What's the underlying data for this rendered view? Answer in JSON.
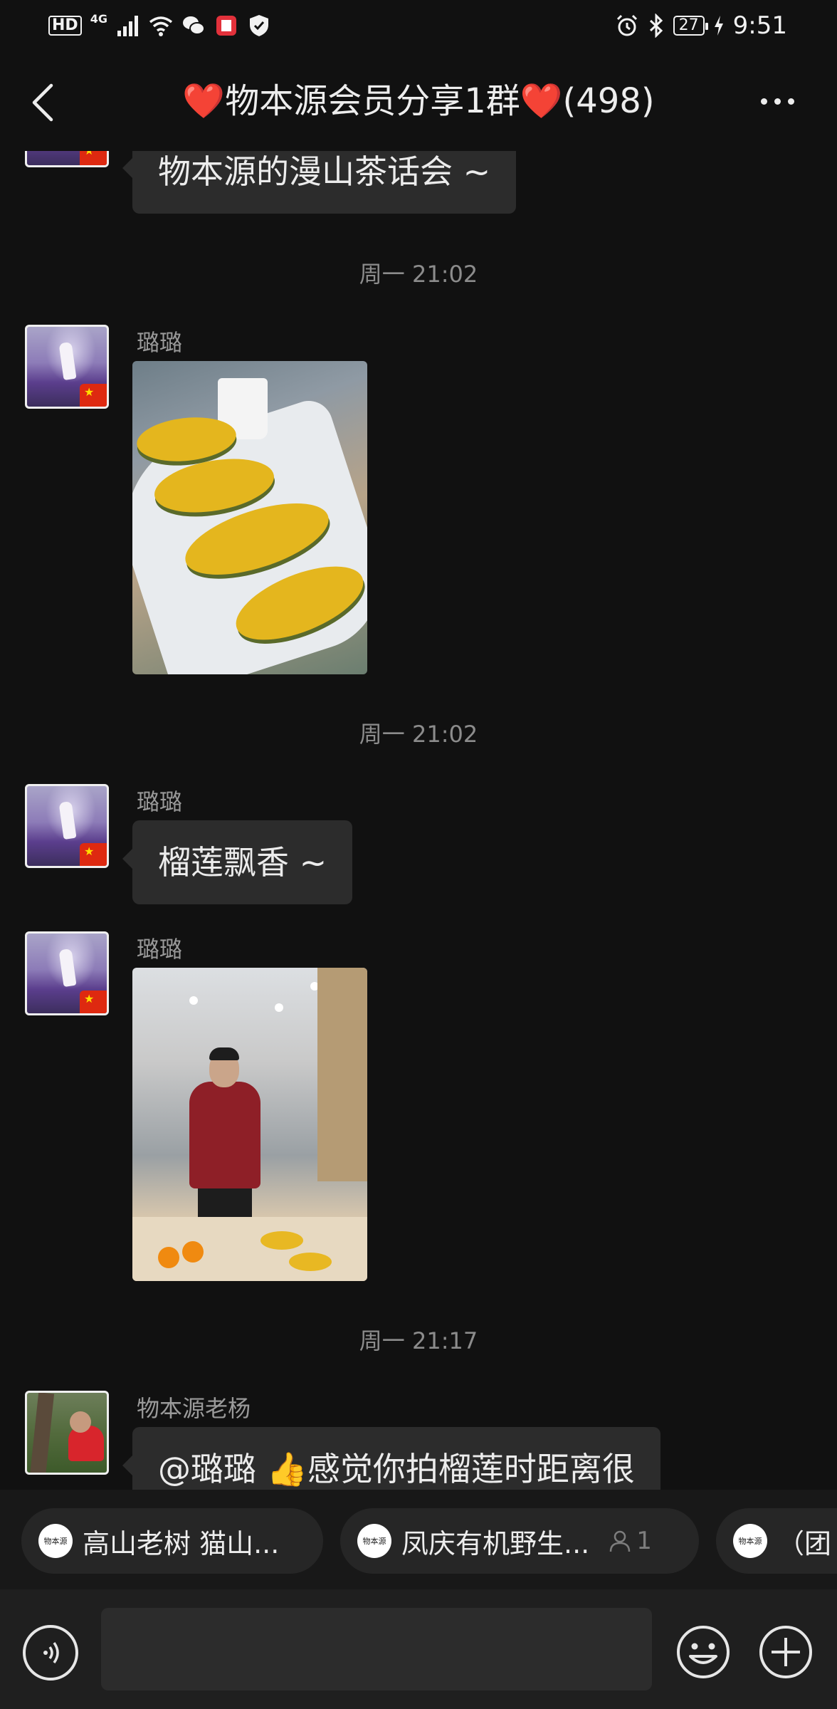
{
  "status_bar": {
    "hd": "HD",
    "network": "4G",
    "battery": "27",
    "time": "9:51"
  },
  "header": {
    "heart_left": "❤️",
    "title": "物本源会员分享1群",
    "heart_right": "❤️",
    "member_count": "(498)"
  },
  "messages": {
    "m1": {
      "text": "物本源的漫山茶话会 ~"
    },
    "t1": "周一 21:02",
    "m2": {
      "sender": "璐璐",
      "type": "image"
    },
    "t2": "周一 21:02",
    "m3": {
      "sender": "璐璐",
      "text": "榴莲飘香 ~"
    },
    "m4": {
      "sender": "璐璐",
      "type": "image"
    },
    "t3": "周一 21:17",
    "m5": {
      "sender": "物本源老杨",
      "text": "@璐璐 👍感觉你拍榴莲时距离很"
    }
  },
  "chips": [
    {
      "logo": "物本源",
      "label": "高山老树  猫山..."
    },
    {
      "logo": "物本源",
      "label": "凤庆有机野生...",
      "count": "1"
    },
    {
      "logo": "物本源",
      "label": "（团"
    }
  ],
  "input": {
    "value": ""
  },
  "colors": {
    "background": "#111111",
    "bubble": "#2c2c2c",
    "heart": "#e21b26"
  }
}
